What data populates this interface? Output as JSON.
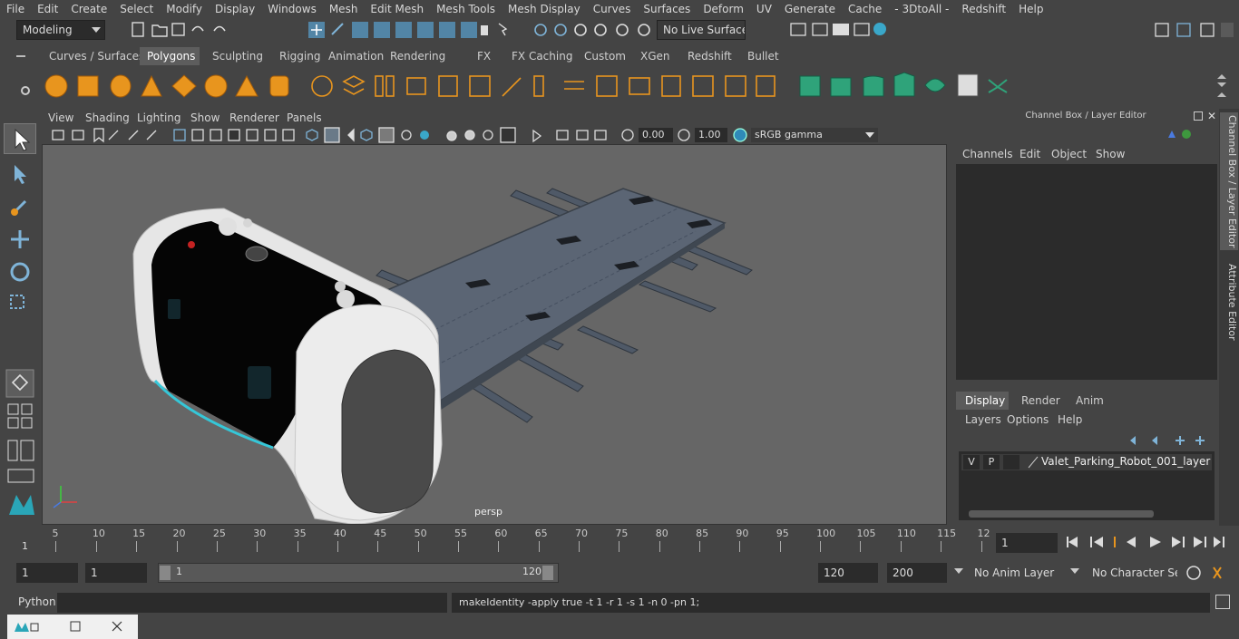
{
  "menubar": {
    "items": [
      "File",
      "Edit",
      "Create",
      "Select",
      "Modify",
      "Display",
      "Windows",
      "Mesh",
      "Edit Mesh",
      "Mesh Tools",
      "Mesh Display",
      "Curves",
      "Surfaces",
      "Deform",
      "UV",
      "Generate",
      "Cache",
      "- 3DtoAll -",
      "Redshift",
      "Help"
    ]
  },
  "statusline": {
    "mode": "Modeling",
    "live_surface": "No Live Surface"
  },
  "shelf": {
    "tabs": [
      "Curves / Surfaces",
      "Polygons",
      "Sculpting",
      "Rigging",
      "Animation",
      "Rendering",
      "FX",
      "FX Caching",
      "Custom",
      "XGen",
      "Redshift",
      "Bullet"
    ],
    "active_tab": "Polygons"
  },
  "viewport": {
    "menu": [
      "View",
      "Shading",
      "Lighting",
      "Show",
      "Renderer",
      "Panels"
    ],
    "exposure": "0.00",
    "gamma": "1.00",
    "color_space": "sRGB gamma",
    "camera_label": "persp"
  },
  "channel_box": {
    "title": "Channel Box / Layer Editor",
    "menu": [
      "Channels",
      "Edit",
      "Object",
      "Show"
    ]
  },
  "layer_editor": {
    "tabs": [
      "Display",
      "Render",
      "Anim"
    ],
    "active_tab": "Display",
    "menu": [
      "Layers",
      "Options",
      "Help"
    ],
    "layers": [
      {
        "visible": "V",
        "playback": "P",
        "name": "Valet_Parking_Robot_001_layer"
      }
    ]
  },
  "side_tabs": [
    "Channel Box / Layer Editor",
    "Attribute Editor"
  ],
  "timeline": {
    "ticks": [
      "5",
      "10",
      "15",
      "20",
      "25",
      "30",
      "35",
      "40",
      "45",
      "50",
      "55",
      "60",
      "65",
      "70",
      "75",
      "80",
      "85",
      "90",
      "95",
      "100",
      "105",
      "110",
      "115",
      "12"
    ],
    "start_marker": "1",
    "current_frame": "1"
  },
  "range": {
    "start": "1",
    "playback_start": "1",
    "slider_start": "1",
    "slider_end": "120",
    "playback_end": "120",
    "end": "200",
    "anim_layer": "No Anim Layer",
    "character_set": "No Character Set"
  },
  "command": {
    "language": "Python",
    "output": "makeIdentity -apply true -t 1 -r 1 -s 1 -n 0 -pn 1;"
  },
  "colors": {
    "accent": "#5285a6",
    "shelf_green": "#2fa37a",
    "robot_shell": "#e6e6e6",
    "robot_panel": "#050505",
    "platform": "#5b6574"
  }
}
